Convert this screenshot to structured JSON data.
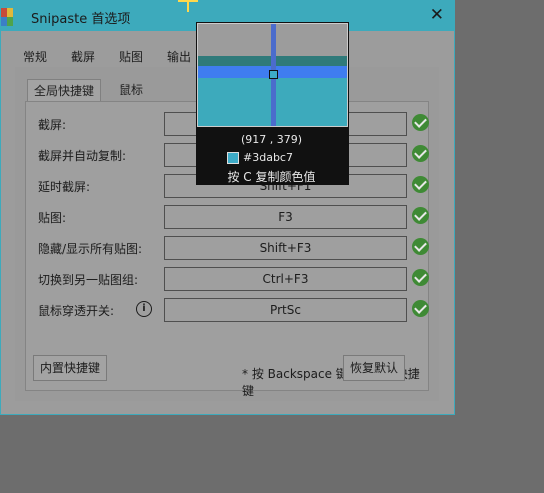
{
  "window": {
    "title": "Snipaste 首选项",
    "close_glyph": "✕"
  },
  "tabs": [
    "常规",
    "截屏",
    "贴图",
    "输出"
  ],
  "subtabs": [
    "全局快捷键",
    "鼠标"
  ],
  "shortcuts": [
    {
      "label": "截屏:",
      "value": ""
    },
    {
      "label": "截屏并自动复制:",
      "value": ""
    },
    {
      "label": "延时截屏:",
      "value": "Shift+F1"
    },
    {
      "label": "贴图:",
      "value": "F3"
    },
    {
      "label": "隐藏/显示所有贴图:",
      "value": "Shift+F3"
    },
    {
      "label": "切换到另一贴图组:",
      "value": "Ctrl+F3"
    },
    {
      "label": "鼠标穿透开关:",
      "value": "PrtSc",
      "info": "i"
    }
  ],
  "hint": "* 按 Backspace 键清除当前快捷键",
  "buttons": {
    "builtin": "内置快捷键",
    "restore": "恢复默认"
  },
  "magnifier": {
    "coords": "(917 , 379)",
    "color_hex": "#3dabc7",
    "copy_hint": "按 C 复制颜色值"
  },
  "colors": {
    "accent": "#3daabc",
    "ok_green": "#3f8a35",
    "picked": "#3dabc7"
  }
}
